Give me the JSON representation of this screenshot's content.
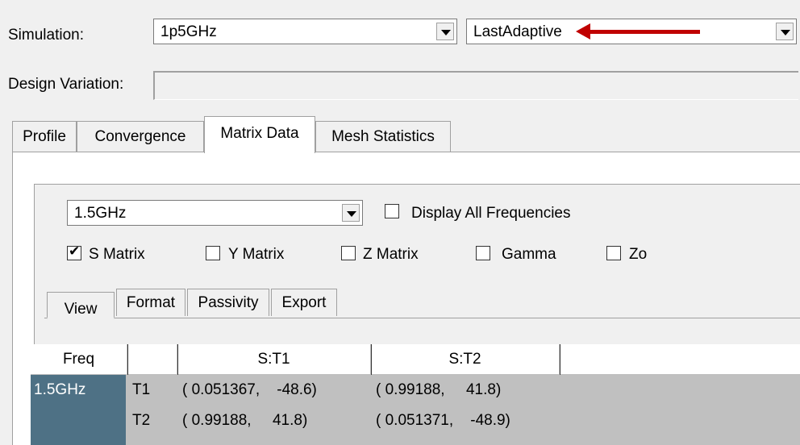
{
  "simulation": {
    "label": "Simulation:",
    "setup_value": "1p5GHz",
    "pass_value": "LastAdaptive"
  },
  "design_variation": {
    "label": "Design Variation:",
    "value": ""
  },
  "tabs": [
    {
      "label": "Profile"
    },
    {
      "label": "Convergence"
    },
    {
      "label": "Matrix Data"
    },
    {
      "label": "Mesh Statistics"
    }
  ],
  "matrix": {
    "frequency_value": "1.5GHz",
    "display_all_label": "Display All Frequencies",
    "options": [
      {
        "label": "S Matrix",
        "checked": true
      },
      {
        "label": "Y Matrix",
        "checked": false
      },
      {
        "label": "Z Matrix",
        "checked": false
      },
      {
        "label": "Gamma",
        "checked": false
      },
      {
        "label": "Zo",
        "checked": false
      }
    ],
    "subtabs": [
      {
        "label": "View"
      },
      {
        "label": "Format"
      },
      {
        "label": "Passivity"
      },
      {
        "label": "Export"
      }
    ]
  },
  "grid": {
    "headers": [
      "Freq",
      "",
      "S:T1",
      "S:T2"
    ],
    "rows": [
      {
        "freq": "1.5GHz",
        "port": "T1",
        "s1": "( 0.051367,    -48.6)",
        "s2": "( 0.99188,     41.8)"
      },
      {
        "freq": "",
        "port": "T2",
        "s1": "( 0.99188,     41.8)",
        "s2": "( 0.051371,    -48.9)"
      }
    ]
  },
  "colors": {
    "annotation": "#c00000",
    "freq_cell": "#4e7185"
  }
}
